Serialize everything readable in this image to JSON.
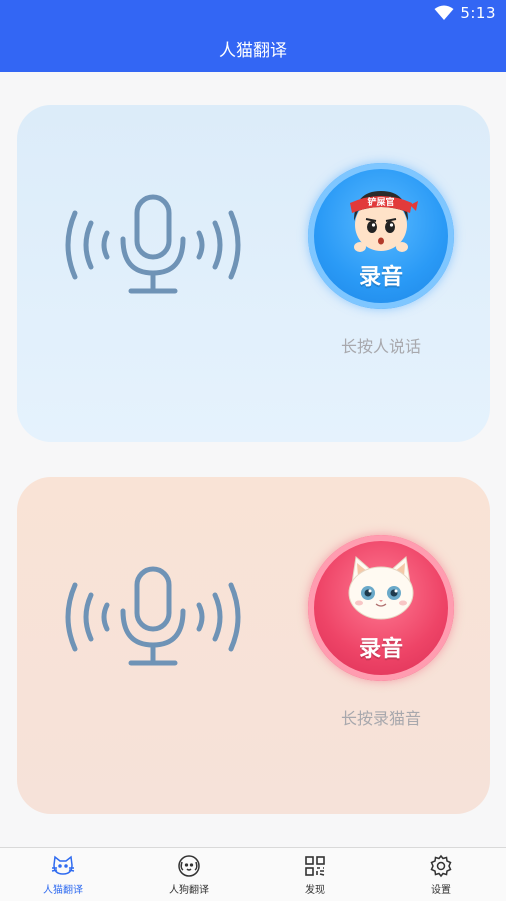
{
  "status_bar": {
    "time": "5:13"
  },
  "header": {
    "title": "人猫翻译"
  },
  "human_card": {
    "record_label": "录音",
    "hint": "长按人说话",
    "headband_text": "铲屎官"
  },
  "cat_card": {
    "record_label": "录音",
    "hint": "长按录猫音"
  },
  "tabs": [
    {
      "label": "人猫翻译",
      "icon": "cat-icon",
      "active": true
    },
    {
      "label": "人狗翻译",
      "icon": "dog-icon",
      "active": false
    },
    {
      "label": "发现",
      "icon": "qr-icon",
      "active": false
    },
    {
      "label": "设置",
      "icon": "gear-icon",
      "active": false
    }
  ],
  "colors": {
    "header": "#3366f4",
    "active_tab": "#2f6bf0",
    "human_card_bg": "#dcecf9",
    "cat_card_bg": "#f9e3d6",
    "mic": "#6f93b6"
  }
}
